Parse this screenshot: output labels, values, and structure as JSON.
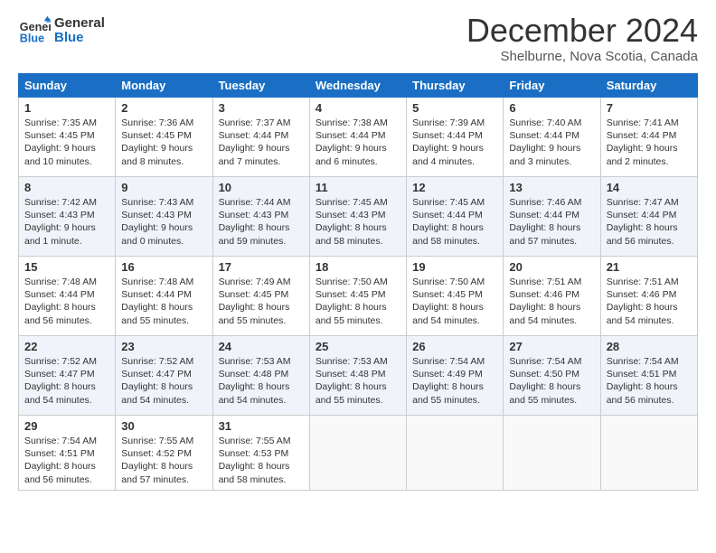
{
  "logo": {
    "line1": "General",
    "line2": "Blue"
  },
  "title": "December 2024",
  "location": "Shelburne, Nova Scotia, Canada",
  "days_of_week": [
    "Sunday",
    "Monday",
    "Tuesday",
    "Wednesday",
    "Thursday",
    "Friday",
    "Saturday"
  ],
  "weeks": [
    [
      {
        "day": "1",
        "info": "Sunrise: 7:35 AM\nSunset: 4:45 PM\nDaylight: 9 hours\nand 10 minutes."
      },
      {
        "day": "2",
        "info": "Sunrise: 7:36 AM\nSunset: 4:45 PM\nDaylight: 9 hours\nand 8 minutes."
      },
      {
        "day": "3",
        "info": "Sunrise: 7:37 AM\nSunset: 4:44 PM\nDaylight: 9 hours\nand 7 minutes."
      },
      {
        "day": "4",
        "info": "Sunrise: 7:38 AM\nSunset: 4:44 PM\nDaylight: 9 hours\nand 6 minutes."
      },
      {
        "day": "5",
        "info": "Sunrise: 7:39 AM\nSunset: 4:44 PM\nDaylight: 9 hours\nand 4 minutes."
      },
      {
        "day": "6",
        "info": "Sunrise: 7:40 AM\nSunset: 4:44 PM\nDaylight: 9 hours\nand 3 minutes."
      },
      {
        "day": "7",
        "info": "Sunrise: 7:41 AM\nSunset: 4:44 PM\nDaylight: 9 hours\nand 2 minutes."
      }
    ],
    [
      {
        "day": "8",
        "info": "Sunrise: 7:42 AM\nSunset: 4:43 PM\nDaylight: 9 hours\nand 1 minute."
      },
      {
        "day": "9",
        "info": "Sunrise: 7:43 AM\nSunset: 4:43 PM\nDaylight: 9 hours\nand 0 minutes."
      },
      {
        "day": "10",
        "info": "Sunrise: 7:44 AM\nSunset: 4:43 PM\nDaylight: 8 hours\nand 59 minutes."
      },
      {
        "day": "11",
        "info": "Sunrise: 7:45 AM\nSunset: 4:43 PM\nDaylight: 8 hours\nand 58 minutes."
      },
      {
        "day": "12",
        "info": "Sunrise: 7:45 AM\nSunset: 4:44 PM\nDaylight: 8 hours\nand 58 minutes."
      },
      {
        "day": "13",
        "info": "Sunrise: 7:46 AM\nSunset: 4:44 PM\nDaylight: 8 hours\nand 57 minutes."
      },
      {
        "day": "14",
        "info": "Sunrise: 7:47 AM\nSunset: 4:44 PM\nDaylight: 8 hours\nand 56 minutes."
      }
    ],
    [
      {
        "day": "15",
        "info": "Sunrise: 7:48 AM\nSunset: 4:44 PM\nDaylight: 8 hours\nand 56 minutes."
      },
      {
        "day": "16",
        "info": "Sunrise: 7:48 AM\nSunset: 4:44 PM\nDaylight: 8 hours\nand 55 minutes."
      },
      {
        "day": "17",
        "info": "Sunrise: 7:49 AM\nSunset: 4:45 PM\nDaylight: 8 hours\nand 55 minutes."
      },
      {
        "day": "18",
        "info": "Sunrise: 7:50 AM\nSunset: 4:45 PM\nDaylight: 8 hours\nand 55 minutes."
      },
      {
        "day": "19",
        "info": "Sunrise: 7:50 AM\nSunset: 4:45 PM\nDaylight: 8 hours\nand 54 minutes."
      },
      {
        "day": "20",
        "info": "Sunrise: 7:51 AM\nSunset: 4:46 PM\nDaylight: 8 hours\nand 54 minutes."
      },
      {
        "day": "21",
        "info": "Sunrise: 7:51 AM\nSunset: 4:46 PM\nDaylight: 8 hours\nand 54 minutes."
      }
    ],
    [
      {
        "day": "22",
        "info": "Sunrise: 7:52 AM\nSunset: 4:47 PM\nDaylight: 8 hours\nand 54 minutes."
      },
      {
        "day": "23",
        "info": "Sunrise: 7:52 AM\nSunset: 4:47 PM\nDaylight: 8 hours\nand 54 minutes."
      },
      {
        "day": "24",
        "info": "Sunrise: 7:53 AM\nSunset: 4:48 PM\nDaylight: 8 hours\nand 54 minutes."
      },
      {
        "day": "25",
        "info": "Sunrise: 7:53 AM\nSunset: 4:48 PM\nDaylight: 8 hours\nand 55 minutes."
      },
      {
        "day": "26",
        "info": "Sunrise: 7:54 AM\nSunset: 4:49 PM\nDaylight: 8 hours\nand 55 minutes."
      },
      {
        "day": "27",
        "info": "Sunrise: 7:54 AM\nSunset: 4:50 PM\nDaylight: 8 hours\nand 55 minutes."
      },
      {
        "day": "28",
        "info": "Sunrise: 7:54 AM\nSunset: 4:51 PM\nDaylight: 8 hours\nand 56 minutes."
      }
    ],
    [
      {
        "day": "29",
        "info": "Sunrise: 7:54 AM\nSunset: 4:51 PM\nDaylight: 8 hours\nand 56 minutes."
      },
      {
        "day": "30",
        "info": "Sunrise: 7:55 AM\nSunset: 4:52 PM\nDaylight: 8 hours\nand 57 minutes."
      },
      {
        "day": "31",
        "info": "Sunrise: 7:55 AM\nSunset: 4:53 PM\nDaylight: 8 hours\nand 58 minutes."
      },
      {
        "day": "",
        "info": ""
      },
      {
        "day": "",
        "info": ""
      },
      {
        "day": "",
        "info": ""
      },
      {
        "day": "",
        "info": ""
      }
    ]
  ]
}
